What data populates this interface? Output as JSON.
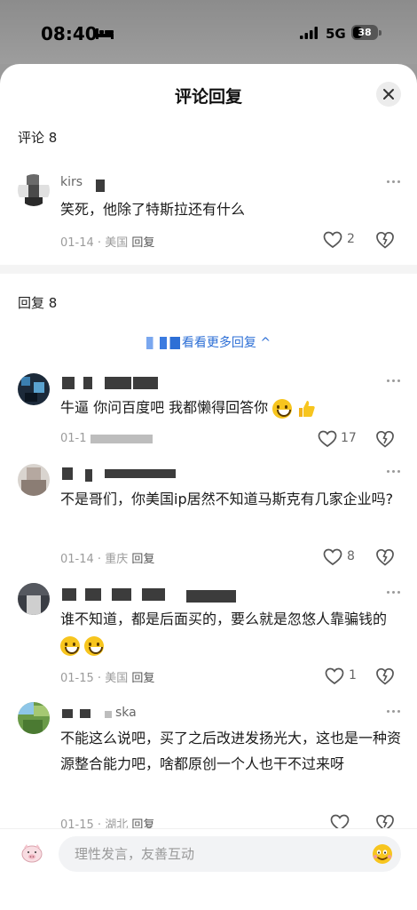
{
  "status_bar": {
    "time": "08:40",
    "network": "5G",
    "battery": "38",
    "battery_level": 0.38
  },
  "sheet": {
    "title": "评论回复"
  },
  "main_comment": {
    "section_label": "评论 8",
    "username": "kirs",
    "text": "笑死，他除了特斯拉还有什么",
    "date": "01-14",
    "location": "美国",
    "reply_label": "回复",
    "likes": "2"
  },
  "replies_section": {
    "label": "回复 8",
    "expand_label": "看看更多回复",
    "expand_arrow": "^"
  },
  "replies": [
    {
      "text": "牛逼 你问百度吧  我都懒得回答你",
      "date": "01-1",
      "location": "",
      "reply_label": "",
      "likes": "17"
    },
    {
      "text": "不是哥们，你美国ip居然不知道马斯克有几家企业吗?",
      "date": "01-14",
      "location": "重庆",
      "reply_label": "回复",
      "likes": "8"
    },
    {
      "text": "谁不知道，都是后面买的，要么就是忽悠人靠骗钱的",
      "date": "01-15",
      "location": "美国",
      "reply_label": "回复",
      "likes": "1"
    },
    {
      "username": "ska",
      "text": "不能这么说吧，买了之后改进发扬光大，这也是一种资源整合能力吧，啥都原创一个人也干不过来呀",
      "date": "01-15",
      "location": "湖北",
      "reply_label": "回复",
      "likes": ""
    }
  ],
  "bottom_bar": {
    "placeholder": "理性发言，友善互动"
  },
  "colors": {
    "link_blue": "#2d6fd6",
    "sheet_bg": "#ffffff",
    "overlay": "#9a9a9a"
  }
}
